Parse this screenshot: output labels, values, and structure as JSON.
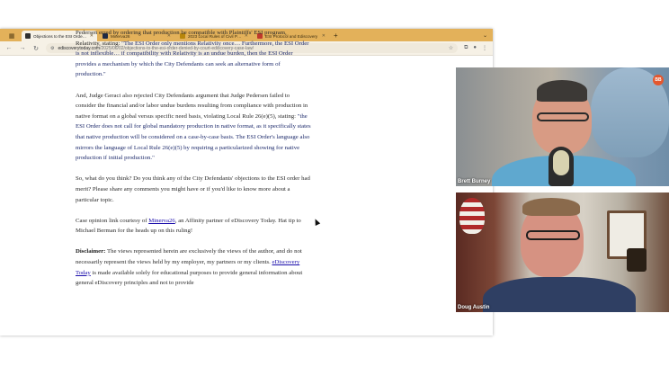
{
  "browser": {
    "tabs": [
      {
        "title": "Objections to the ESI Order Denied by Court",
        "favicon_color": "#2f2f2f",
        "active": true
      },
      {
        "title": "Minerva26",
        "favicon_color": "#1f2a44",
        "active": false
      },
      {
        "title": "2023 Local Rules of Civil Practice",
        "favicon_color": "#b8860b",
        "active": false
      },
      {
        "title": "ESI Protocol and Ediscovery",
        "favicon_color": "#c0392b",
        "active": false
      }
    ],
    "new_tab_label": "+",
    "url_domain": "ediscoverytoday.com",
    "url_path": "/2025/06/02/objections-to-the-esi-order-denied-by-court-ediscovery-case-law/"
  },
  "article": {
    "p1_intro": "Pedersen erred by ordering that production be compatible with Plaintiffs' ESI program, Relativity, stating: ",
    "p1_quote": "\"The ESI Order only mentions Relativity once… Furthermore, the ESI Order is not inflexible… if compatibility with Relativity is an undue burden, then the ESI Order provides a mechanism by which the City Defendants can seek an alternative form of production.\"",
    "p2_intro": "And, Judge Geraci also rejected City Defendants argument that Judge Pedersen failed to consider the financial and/or labor undue burdens resulting from compliance with production in native format on a global versus specific need basis, violating Local Rule 26(e)(5), stating: ",
    "p2_quote": "\"the ESI Order does not call for global mandatory production in native format, as it specifically states that native production will be considered on a case-by-case basis. The ESI Order's language also mirrors the language of Local Rule 26(e)(5) by requiring a particularized showing for native production if initial production.\"",
    "p3": "So, what do you think? Do you think any of the City Defendants' objections to the ESI order had merit? Please share any comments you might have or if you'd like to know more about a particular topic.",
    "p4_before": "Case opinion link courtesy of ",
    "p4_link": "Minerva26",
    "p4_after": ", an Affinity partner of eDiscovery Today. Hat tip to Michael Berman for the heads up on this ruling!",
    "p5_label": "Disclaimer:",
    "p5_text1": " The views represented herein are exclusively the views of the author, and do not necessarily represent the views held by my employer, my partners or my clients. ",
    "p5_link": "eDiscovery Today",
    "p5_text2": " is made available solely for educational purposes to provide general information about general eDiscovery principles and not to provide"
  },
  "videos": [
    {
      "name": "Brett Burney",
      "badge": "BB"
    },
    {
      "name": "Doug Austin"
    }
  ]
}
